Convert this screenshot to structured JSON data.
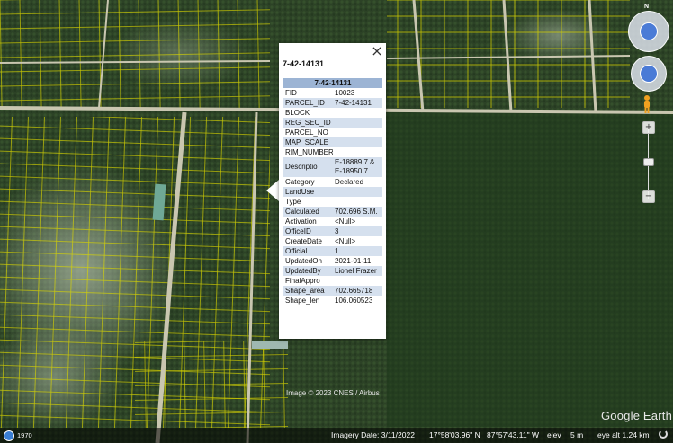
{
  "balloon": {
    "title": "7-42-14131",
    "table_header": "7-42-14131",
    "close_label": "×",
    "rows": [
      {
        "key": "FID",
        "value": "10023"
      },
      {
        "key": "PARCEL_ID",
        "value": "7-42-14131"
      },
      {
        "key": "BLOCK",
        "value": ""
      },
      {
        "key": "REG_SEC_ID",
        "value": ""
      },
      {
        "key": "PARCEL_NO",
        "value": ""
      },
      {
        "key": "MAP_SCALE",
        "value": ""
      },
      {
        "key": "RIM_NUMBER",
        "value": ""
      },
      {
        "key": "Descriptio",
        "value": "E-18889 7 & E-18950 7"
      },
      {
        "key": "Category",
        "value": "Declared"
      },
      {
        "key": "LandUse",
        "value": ""
      },
      {
        "key": "Type",
        "value": ""
      },
      {
        "key": "Calculated",
        "value": "702.696 S.M."
      },
      {
        "key": "Activation",
        "value": "<Null>"
      },
      {
        "key": "OfficeID",
        "value": "3"
      },
      {
        "key": "CreateDate",
        "value": "<Null>"
      },
      {
        "key": "Official",
        "value": "1"
      },
      {
        "key": "UpdatedOn",
        "value": "2021-01-11"
      },
      {
        "key": "UpdatedBy",
        "value": "Lionel Frazer"
      },
      {
        "key": "FinalAppro",
        "value": ""
      },
      {
        "key": "Shape_area",
        "value": "702.665718"
      },
      {
        "key": "Shape_len",
        "value": "106.060523"
      }
    ]
  },
  "map": {
    "copyright": "Image © 2023 CNES / Airbus",
    "logo": "Google Earth",
    "compass_label": "N",
    "colors": {
      "parcel_lines": "#e8e000",
      "vegetation": "#2f4a25",
      "sand": "#b8b49a",
      "header_blue": "#9cb4d4",
      "row_alt": "#d5e0ee"
    }
  },
  "status": {
    "year": "1970",
    "imagery_date": "Imagery Date: 3/11/2022",
    "lat": "17°58'03.96\" N",
    "lon": "87°57'43.11\" W",
    "elev_label": "elev",
    "elev_value": "5 m",
    "eye_alt": "eye alt  1.24 km"
  },
  "controls": {
    "zoom_in": "+",
    "zoom_out": "−"
  }
}
